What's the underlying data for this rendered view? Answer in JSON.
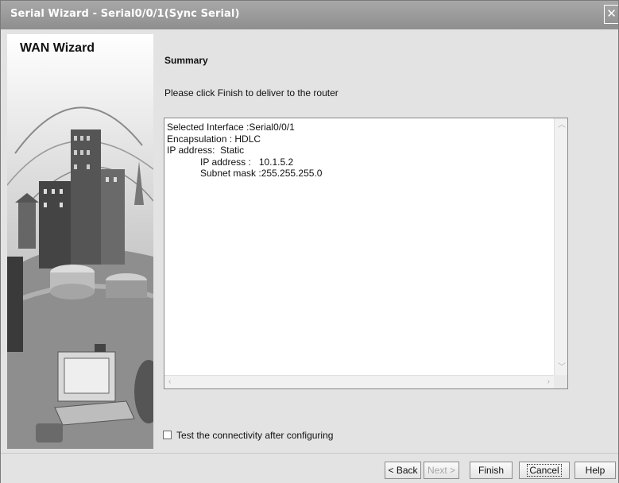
{
  "window": {
    "title": "Serial Wizard - Serial0/0/1(Sync Serial)",
    "close_icon": "close-x"
  },
  "sidebar": {
    "title": "WAN Wizard",
    "illustration": "city-network-illustration"
  },
  "main": {
    "heading": "Summary",
    "instruction": "Please click Finish to deliver to the router",
    "summary_lines": [
      "Selected Interface :Serial0/0/1",
      "Encapsulation : HDLC",
      "IP address:  Static",
      "IP address :   10.1.5.2",
      "Subnet mask :255.255.255.0"
    ],
    "checkbox": {
      "label": "Test the connectivity after configuring",
      "checked": false
    }
  },
  "buttons": {
    "back": "< Back",
    "next": "Next >",
    "finish": "Finish",
    "cancel": "Cancel",
    "help": "Help"
  },
  "colors": {
    "titlebar": "#9a9a9a",
    "background": "#e3e3e3"
  }
}
